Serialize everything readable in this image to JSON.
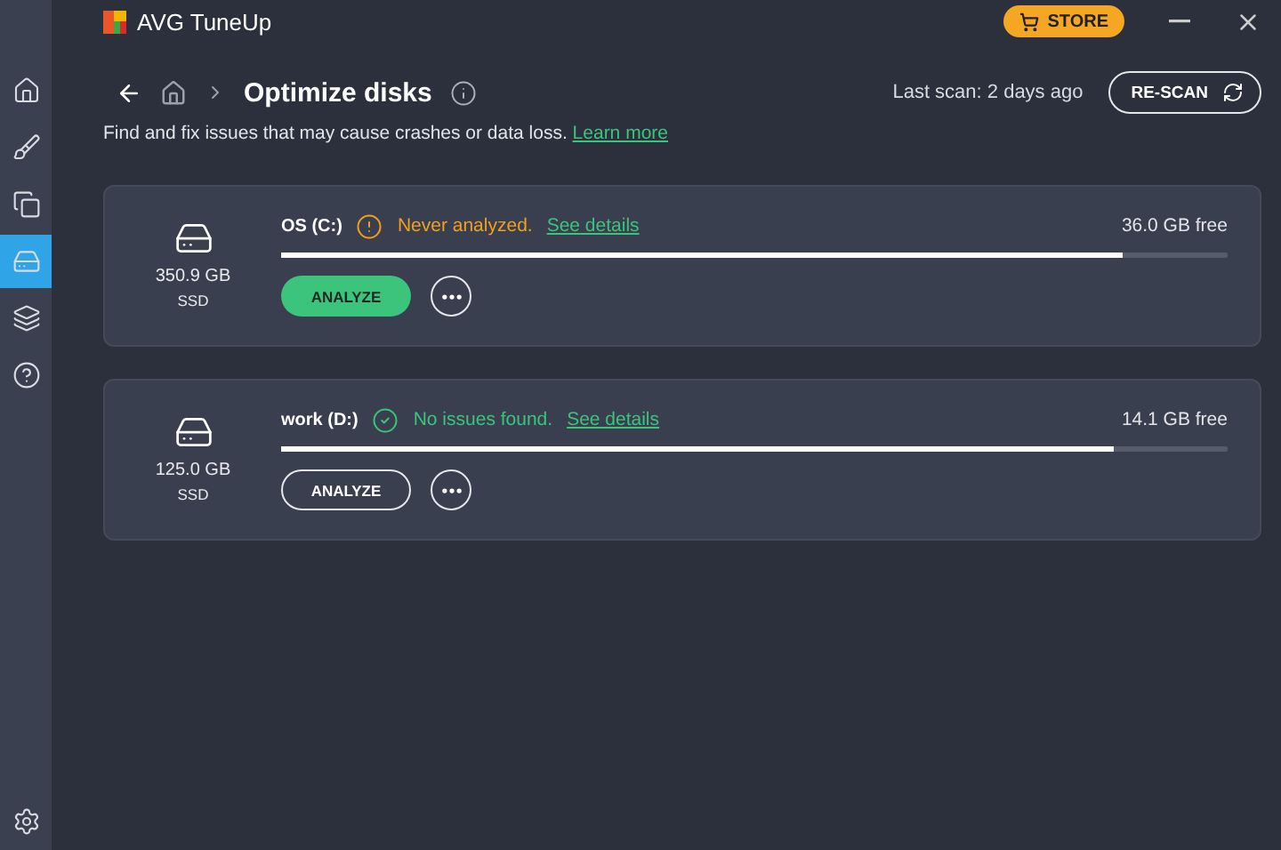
{
  "window": {
    "title": "AVG TuneUp",
    "store_button": "STORE"
  },
  "sidebar": {
    "items": [
      {
        "selected": false
      },
      {
        "selected": false
      },
      {
        "selected": false
      },
      {
        "selected": true
      },
      {
        "selected": false
      },
      {
        "selected": false
      }
    ]
  },
  "header": {
    "title": "Optimize disks",
    "description": "Find and fix issues that may cause crashes or data loss.",
    "learn_more": "Learn more",
    "last_scan": "Last scan: 2 days ago",
    "rescan_button": "RE-SCAN"
  },
  "disks": [
    {
      "size": "350.9 GB",
      "type": "SSD",
      "name": "OS (C:)",
      "kind": "warning",
      "status": "Never analyzed.",
      "details_link": "See details",
      "free": "36.0 GB free",
      "level": 0.89,
      "analyze": {
        "label": "ANALYZE",
        "kind": "primary"
      }
    },
    {
      "size": "125.0 GB",
      "type": "SSD",
      "name": "work (D:)",
      "kind": "ok",
      "status": "No issues found.",
      "details_link": "See details",
      "free": "14.1 GB free",
      "level": 0.88,
      "analyze": {
        "label": "ANALYZE",
        "kind": "outline"
      }
    }
  ]
}
